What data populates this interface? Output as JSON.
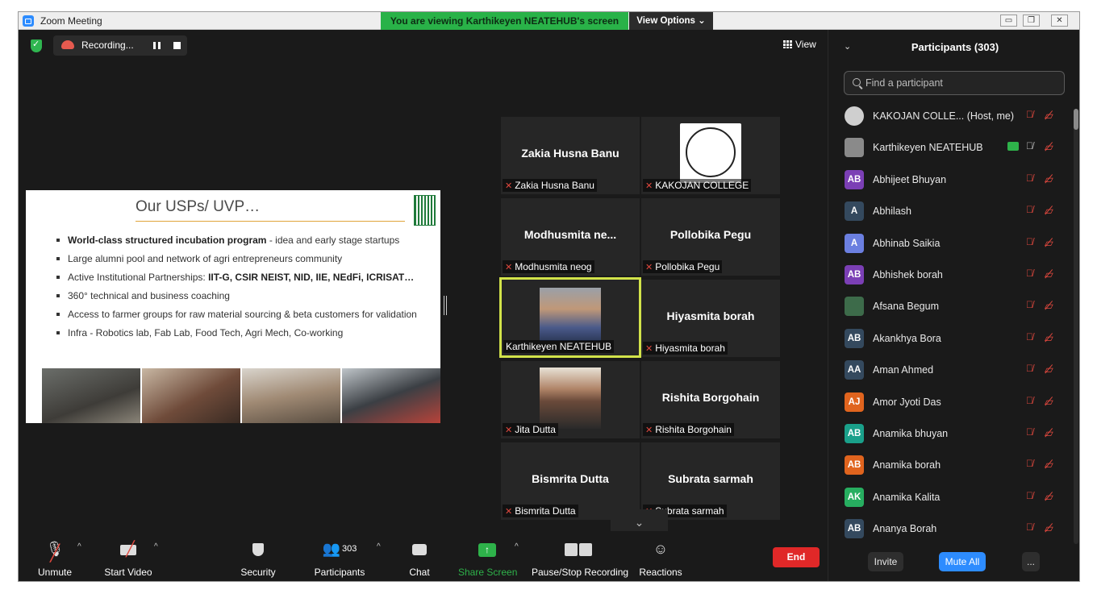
{
  "window": {
    "title": "Zoom Meeting",
    "viewing_banner": "You are viewing Karthikeyen NEATEHUB's screen",
    "view_options": "View Options ⌄"
  },
  "top_bar": {
    "recording_label": "Recording...",
    "view_label": "View"
  },
  "slide": {
    "title": "Our USPs/ UVP…",
    "bullets": [
      {
        "bold": "World-class structured incubation program",
        "rest": " - idea and early stage startups"
      },
      {
        "bold": "",
        "rest": "Large alumni pool and network of agri entrepreneurs community"
      },
      {
        "bold": "IIT-G, CSIR NEIST, NID, IIE, NEdFi, ICRISAT…",
        "prefix": "Active Institutional Partnerships: ",
        "rest": ""
      },
      {
        "bold": "",
        "rest": "360° technical and business coaching"
      },
      {
        "bold": "",
        "rest": "Access to farmer groups for raw material sourcing & beta customers for validation"
      },
      {
        "bold": "",
        "rest": "Infra - Robotics lab, Fab Lab, Food Tech, Agri Mech, Co-working"
      }
    ]
  },
  "gallery": [
    {
      "center": "Zakia Husna Banu",
      "label": "Zakia Husna Banu"
    },
    {
      "center": "",
      "label": "KAKOJAN COLLEGE"
    },
    {
      "center": "Modhusmita  ne...",
      "label": "Modhusmita neog"
    },
    {
      "center": "Pollobika Pegu",
      "label": "Pollobika Pegu"
    },
    {
      "center": "",
      "label": "Karthikeyen NEATEHUB"
    },
    {
      "center": "Hiyasmita borah",
      "label": "Hiyasmita borah"
    },
    {
      "center": "",
      "label": "Jita Dutta"
    },
    {
      "center": "Rishita Borgohain",
      "label": "Rishita Borgohain"
    },
    {
      "center": "Bismrita Dutta",
      "label": "Bismrita Dutta"
    },
    {
      "center": "Subrata sarmah",
      "label": "Subrata sarmah"
    }
  ],
  "toolbar": {
    "unmute": "Unmute",
    "start_video": "Start Video",
    "security": "Security",
    "participants": "Participants",
    "participants_count": "303",
    "chat": "Chat",
    "share_screen": "Share Screen",
    "pause_stop_recording": "Pause/Stop Recording",
    "reactions": "Reactions",
    "end": "End"
  },
  "panel": {
    "title": "Participants (303)",
    "search_placeholder": "Find a participant",
    "invite": "Invite",
    "mute_all": "Mute All",
    "more": "...",
    "participants": [
      {
        "initials": "",
        "name": "KAKOJAN COLLE... (Host, me)",
        "color": "#cfcfcf"
      },
      {
        "initials": "",
        "name": "Karthikeyen NEATEHUB",
        "color": "#8a8a8a"
      },
      {
        "initials": "AB",
        "name": "Abhijeet Bhuyan",
        "color": "#7b3fb5"
      },
      {
        "initials": "A",
        "name": "Abhilash",
        "color": "#34495e"
      },
      {
        "initials": "A",
        "name": "Abhinab Saikia",
        "color": "#6b7fe0"
      },
      {
        "initials": "AB",
        "name": "Abhishek borah",
        "color": "#7b3fb5"
      },
      {
        "initials": "",
        "name": "Afsana Begum",
        "color": "#3d6b4a"
      },
      {
        "initials": "AB",
        "name": "Akankhya Bora",
        "color": "#34495e"
      },
      {
        "initials": "AA",
        "name": "Aman Ahmed",
        "color": "#34495e"
      },
      {
        "initials": "AJ",
        "name": "Amor Jyoti Das",
        "color": "#e0641e"
      },
      {
        "initials": "AB",
        "name": "Anamika bhuyan",
        "color": "#1aa08a"
      },
      {
        "initials": "AB",
        "name": "Anamika borah",
        "color": "#e0641e"
      },
      {
        "initials": "AK",
        "name": "Anamika Kalita",
        "color": "#27ae60"
      },
      {
        "initials": "AB",
        "name": "Ananya Borah",
        "color": "#34495e"
      }
    ]
  }
}
